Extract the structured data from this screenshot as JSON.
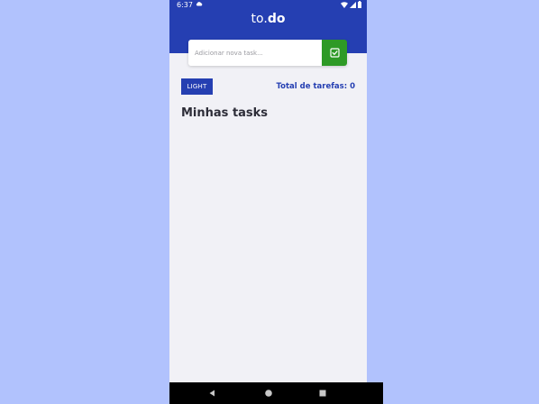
{
  "status_bar": {
    "time": "6:37",
    "icons": [
      "cloud-icon",
      "wifi-icon",
      "signal-icon",
      "battery-icon"
    ]
  },
  "header": {
    "title_prefix": "to.",
    "title_suffix": "do",
    "background_color": "#253fb2"
  },
  "new_task": {
    "placeholder": "Adicionar nova task...",
    "value": "",
    "add_button_icon": "check-square-icon",
    "add_button_color": "#2e9a26"
  },
  "toolbar": {
    "theme_button_label": "LIGHT",
    "total_tasks_label": "Total de tarefas: 0"
  },
  "tasks": {
    "section_title": "Minhas tasks",
    "items": []
  },
  "navigation": {
    "icons": [
      "back-icon",
      "home-icon",
      "recents-icon"
    ]
  },
  "colors": {
    "accent": "#253fb2",
    "success": "#2e9a26",
    "page_background": "#b1c2fd",
    "app_background": "#f1f1f6"
  }
}
